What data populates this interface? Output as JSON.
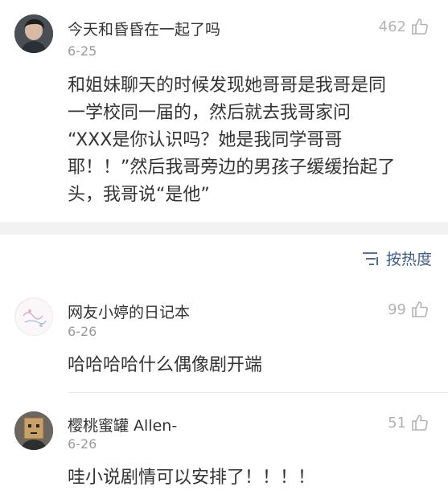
{
  "comments": [
    {
      "username": "今天和昏昏在一起了吗",
      "date": "6-25",
      "likes": "462",
      "lines": [
        "和姐妹聊天的时候发现她哥哥是我哥是同",
        "一学校同一届的，然后就去我哥家问",
        "“XXX是你认识吗？她是我同学哥哥",
        "耶！！”然后我哥旁边的男孩子缓缓抬起了",
        "头，我哥说“是他”"
      ]
    },
    {
      "username": "网友小婷的日记本",
      "date": "6-26",
      "likes": "99",
      "text": "哈哈哈哈什么偶像剧开端"
    },
    {
      "username": "樱桃蜜罐 Allen-",
      "date": "6-26",
      "likes": "51",
      "text": "哇小说剧情可以安排了！！！！"
    }
  ],
  "sort": {
    "label": "按热度"
  },
  "icons": {
    "like": "thumbs-up-icon",
    "sort": "sort-lines-icon"
  },
  "colors": {
    "link": "#3f5d8c",
    "meta": "#9b9b9b",
    "separator": "#f2f2f2"
  }
}
